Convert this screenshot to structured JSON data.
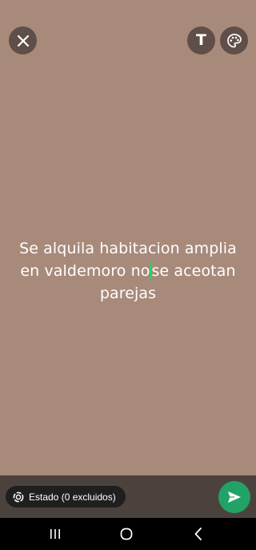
{
  "status": {
    "text_before_caret": "Se alquila habitacion amplia en valdemoro no",
    "text_after_caret": "se aceotan parejas"
  },
  "toolbar": {
    "close_icon": "close-icon",
    "text_icon": "text-format-icon",
    "text_glyph": "T",
    "palette_icon": "palette-icon"
  },
  "audience": {
    "label": "Estado (0 excluidos)",
    "icon": "status-ring-icon"
  },
  "send": {
    "icon": "send-icon"
  },
  "navigation": {
    "recents_icon": "recents-icon",
    "home_icon": "home-icon",
    "back_icon": "back-icon"
  },
  "colors": {
    "background": "#a88a7b",
    "bottom_bar": "#4b423e",
    "accent": "#21a366",
    "caret": "#25d366"
  }
}
